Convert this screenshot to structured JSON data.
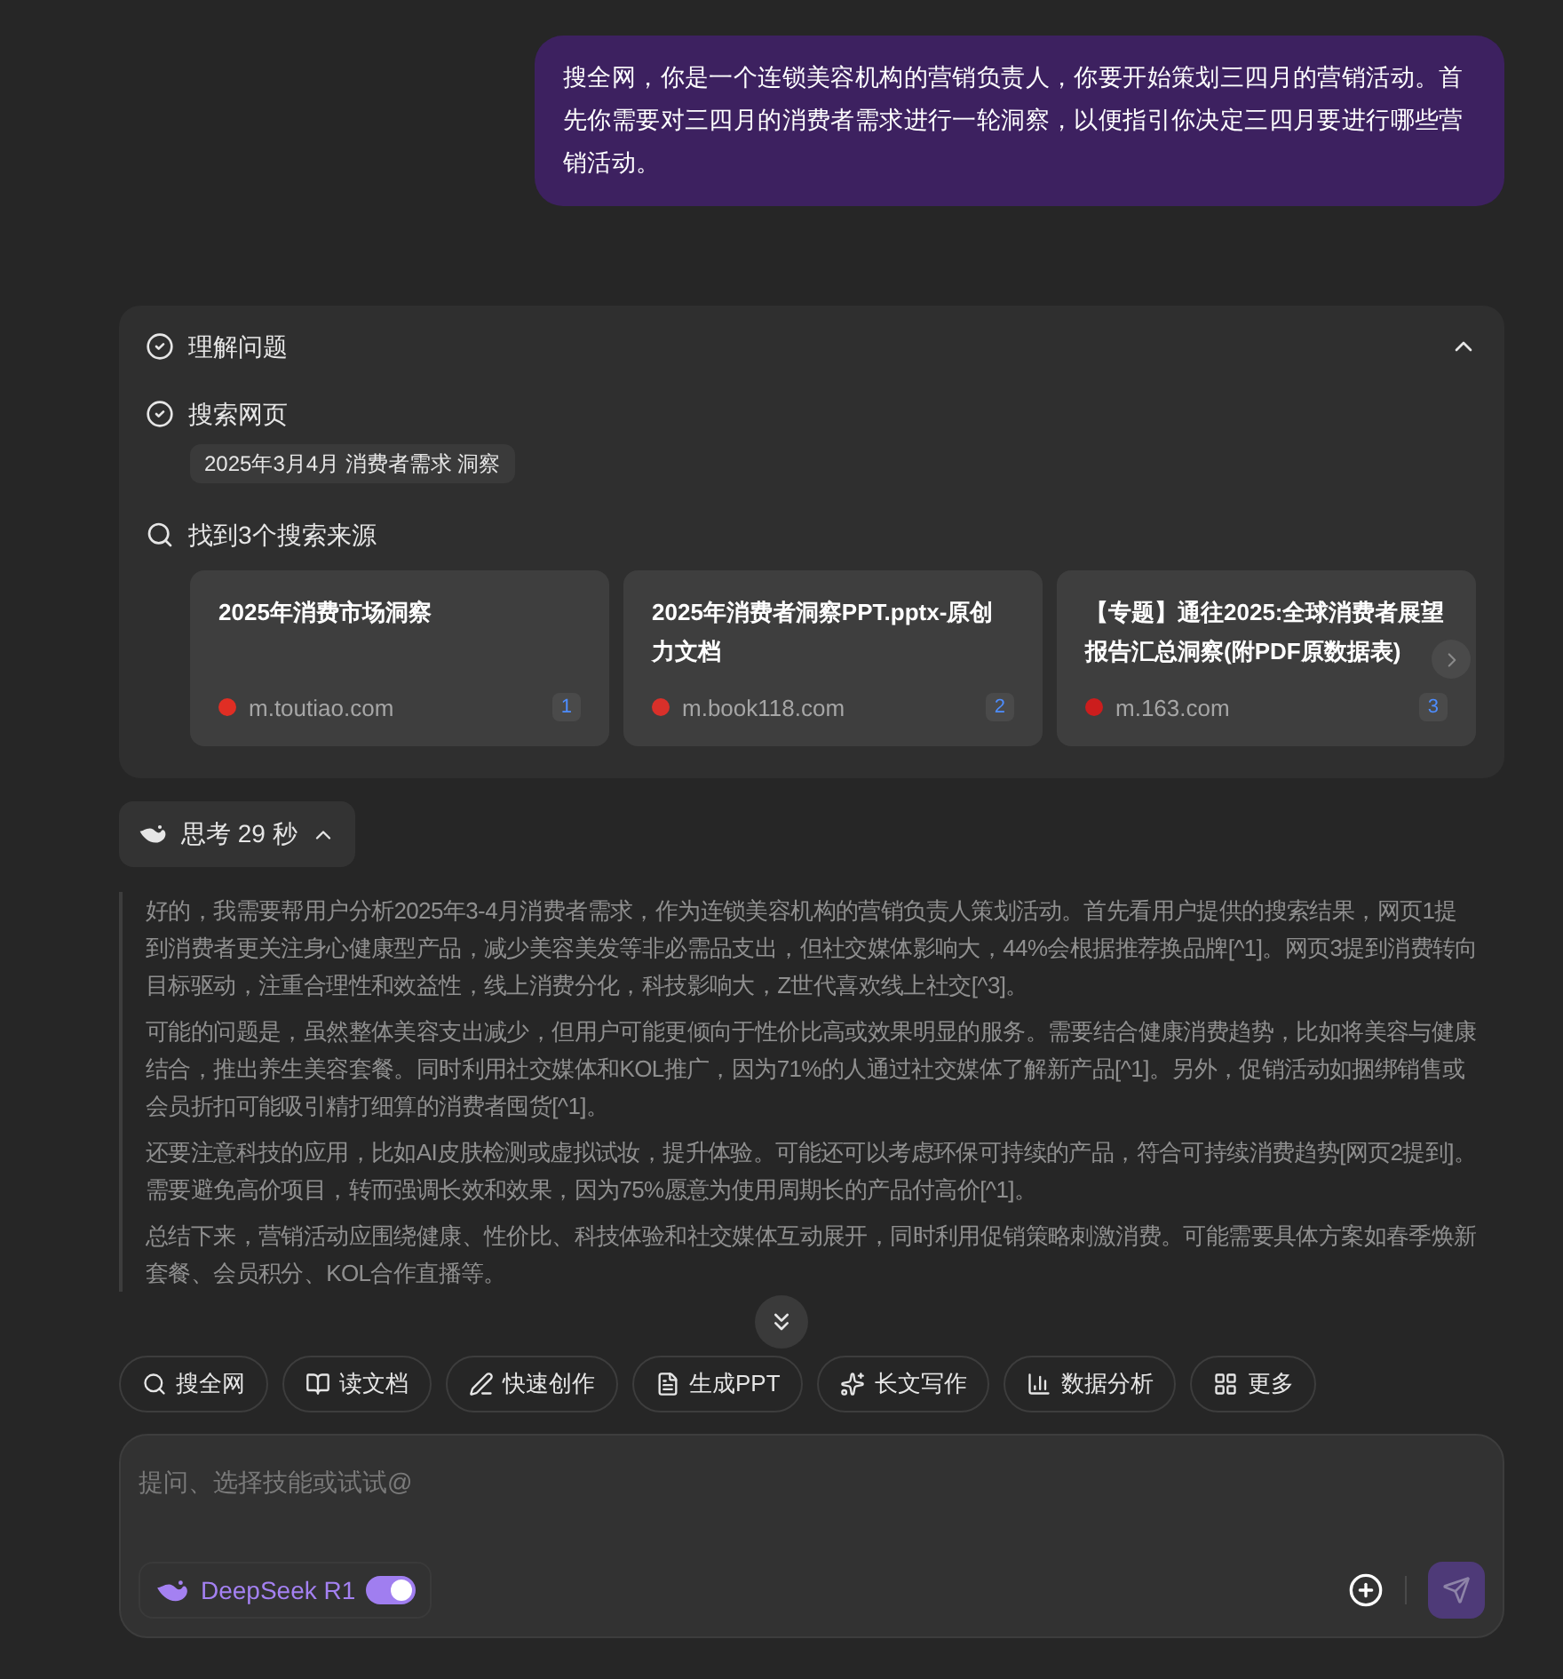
{
  "user_message": "搜全网，你是一个连锁美容机构的营销负责人，你要开始策划三四月的营销活动。首先你需要对三四月的消费者需求进行一轮洞察，以便指引你决定三四月要进行哪些营销活动。",
  "process": {
    "expanded": true,
    "steps": [
      {
        "kind": "done",
        "label": "理解问题"
      },
      {
        "kind": "done",
        "label": "搜索网页",
        "query": "2025年3月4月 消费者需求 洞察"
      },
      {
        "kind": "search",
        "label": "找到3个搜索来源"
      }
    ],
    "sources": [
      {
        "title": "2025年消费市场洞察",
        "site": "m.toutiao.com",
        "index": "1",
        "color": "#e02e24"
      },
      {
        "title": "2025年消费者洞察PPT.pptx-原创力文档",
        "site": "m.book118.com",
        "index": "2",
        "color": "#d9302a"
      },
      {
        "title": "【专题】通往2025:全球消费者展望报告汇总洞察(附PDF原数据表)",
        "site": "m.163.com",
        "index": "3",
        "color": "#cc1d1d"
      }
    ]
  },
  "thinking": {
    "label": "思考 29 秒",
    "expanded": true,
    "paragraphs": [
      "好的，我需要帮用户分析2025年3-4月消费者需求，作为连锁美容机构的营销负责人策划活动。首先看用户提供的搜索结果，网页1提到消费者更关注身心健康型产品，减少美容美发等非必需品支出，但社交媒体影响大，44%会根据推荐换品牌[^1]。网页3提到消费转向目标驱动，注重合理性和效益性，线上消费分化，科技影响大，Z世代喜欢线上社交[^3]。",
      "可能的问题是，虽然整体美容支出减少，但用户可能更倾向于性价比高或效果明显的服务。需要结合健康消费趋势，比如将美容与健康结合，推出养生美容套餐。同时利用社交媒体和KOL推广，因为71%的人通过社交媒体了解新产品[^1]。另外，促销活动如捆绑销售或会员折扣可能吸引精打细算的消费者囤货[^1]。",
      "还要注意科技的应用，比如AI皮肤检测或虚拟试妆，提升体验。可能还可以考虑环保可持续的产品，符合可持续消费趋势[网页2提到]。需要避免高价项目，转而强调长效和效果，因为75%愿意为使用周期长的产品付高价[^1]。",
      "总结下来，营销活动应围绕健康、性价比、科技体验和社交媒体互动展开，同时利用促销策略刺激消费。可能需要具体方案如春季焕新套餐、会员积分、KOL合作直播等。"
    ]
  },
  "skills": [
    {
      "kind": "search",
      "label": "搜全网"
    },
    {
      "kind": "read",
      "label": "读文档"
    },
    {
      "kind": "create",
      "label": "快速创作"
    },
    {
      "kind": "ppt",
      "label": "生成PPT"
    },
    {
      "kind": "write",
      "label": "长文写作"
    },
    {
      "kind": "data",
      "label": "数据分析"
    },
    {
      "kind": "more",
      "label": "更多"
    }
  ],
  "input": {
    "placeholder": "提问、选择技能或试试@",
    "model": "DeepSeek R1",
    "deep_think_on": true
  }
}
